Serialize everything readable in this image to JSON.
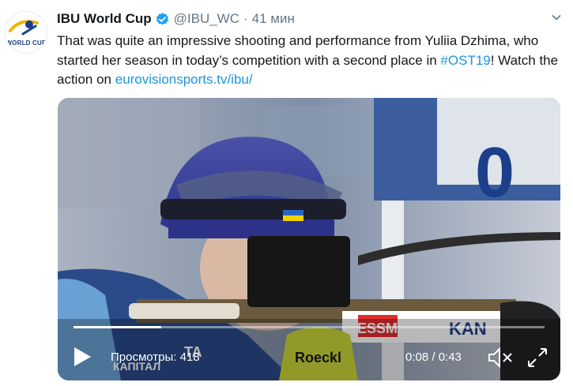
{
  "tweet": {
    "author_name": "IBU World Cup",
    "handle": "@IBU_WC",
    "separator": "·",
    "time": "41 мин",
    "avatar_text": "WORLD CUP",
    "text_part1": "That was quite an impressive shooting and performance from Yuliia Dzhima, who started her season in today’s competition with a second place in ",
    "hashtag": "#OST19",
    "text_part2": "! Watch the action on ",
    "link": "eurovisionsports.tv/ibu/"
  },
  "video": {
    "views": "Просмотры: 418",
    "timecode": "0:08 / 0:43",
    "progress": 0.186,
    "scene_text": {
      "bib_number": "0",
      "sponsor_viessmann": "VIESSMANN",
      "sponsor_kan": "KAN",
      "sponsor_roeckl": "Roeckl",
      "sponsor_kapital": "КАПІТАЛ",
      "sponsor_ta": "TA"
    }
  },
  "icons": {
    "verified": "verified-badge-icon",
    "caret": "chevron-down-icon",
    "play": "play-icon",
    "mute": "volume-muted-icon",
    "fullscreen": "fullscreen-icon"
  },
  "colors": {
    "link": "#1b95e0",
    "verified": "#1da1f2",
    "text": "#14171a",
    "muted": "#657786"
  }
}
